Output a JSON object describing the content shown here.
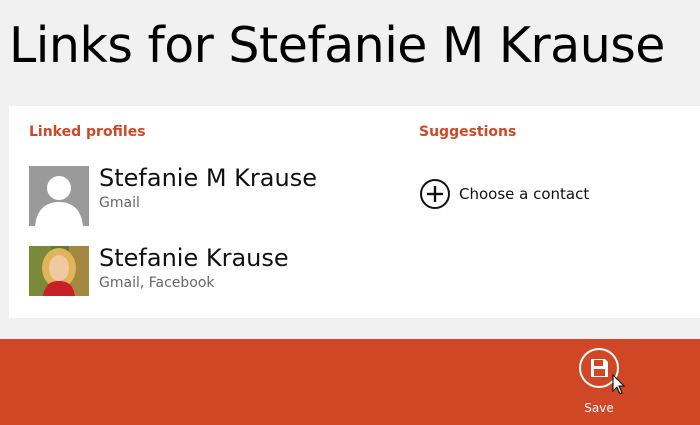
{
  "page": {
    "title": "Links for Stefanie M Krause"
  },
  "linked_profiles": {
    "heading": "Linked profiles",
    "items": [
      {
        "name": "Stefanie M Krause",
        "source": "Gmail",
        "avatar": "default-person-icon"
      },
      {
        "name": "Stefanie Krause",
        "source": "Gmail, Facebook",
        "avatar": "photo"
      }
    ]
  },
  "suggestions": {
    "heading": "Suggestions",
    "choose_label": "Choose a contact",
    "icon": "plus-circle-icon"
  },
  "app_bar": {
    "save_label": "Save",
    "save_icon": "save-icon"
  },
  "colors": {
    "accent": "#d04726",
    "background": "#f1f1f1",
    "panel": "#ffffff"
  }
}
